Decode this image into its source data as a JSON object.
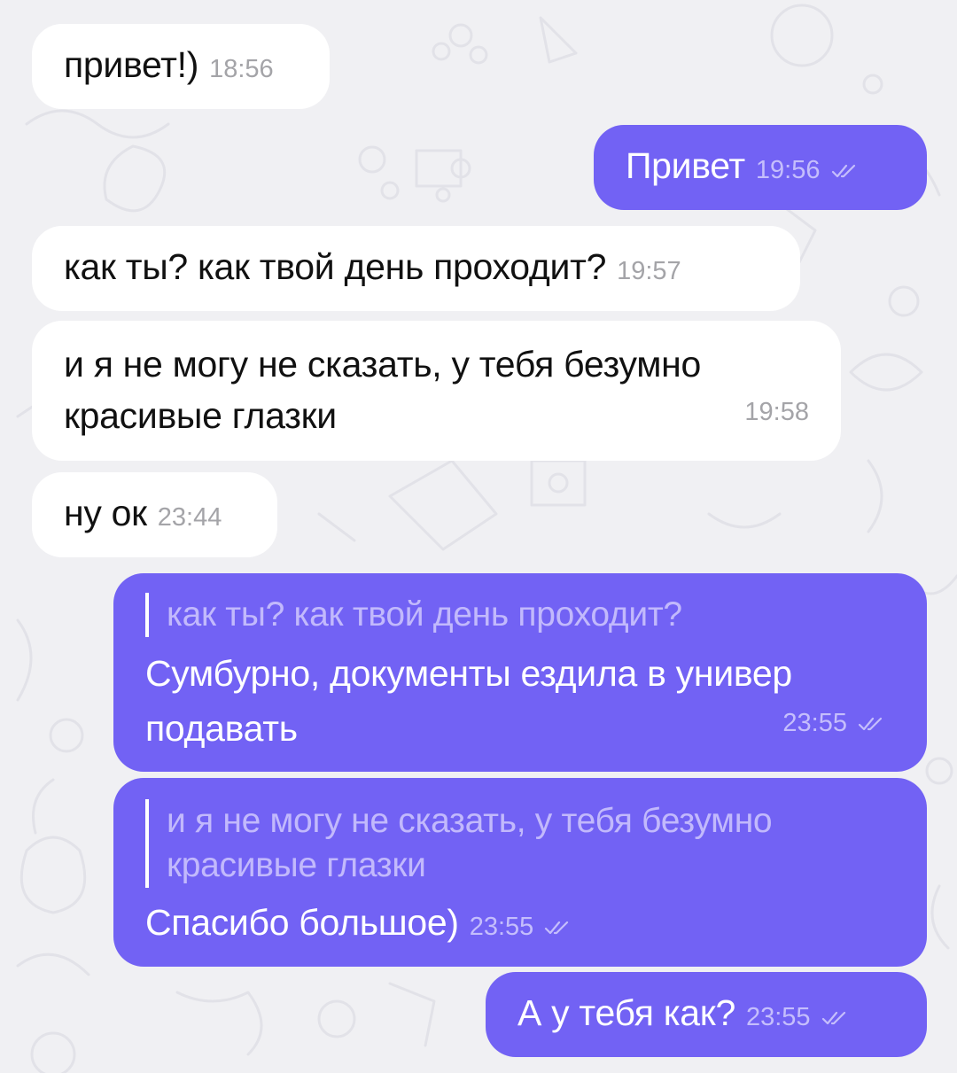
{
  "colors": {
    "chat_background": "#f0f0f3",
    "incoming_bubble": "#ffffff",
    "outgoing_bubble": "#7262f4",
    "incoming_text": "#111111",
    "outgoing_text": "#ffffff",
    "incoming_time": "#a4a4a8",
    "outgoing_time": "#c5befc"
  },
  "icons": {
    "read_status": "double-check-icon",
    "background_pattern": "doodle-pattern"
  },
  "messages": [
    {
      "direction": "in",
      "text": "привет!)",
      "time": "18:56"
    },
    {
      "direction": "out",
      "text": "Привет",
      "time": "19:56",
      "status": "read"
    },
    {
      "direction": "in",
      "text": "как ты? как твой день проходит?",
      "time": "19:57"
    },
    {
      "direction": "in",
      "text_lines": [
        "и я не могу не сказать, у тебя безумно",
        "красивые глазки"
      ],
      "time": "19:58"
    },
    {
      "direction": "in",
      "text": "ну ок",
      "time": "23:44"
    },
    {
      "direction": "out",
      "reply_to": "как ты? как твой день проходит?",
      "text_lines": [
        "Сумбурно, документы ездила в универ",
        "подавать"
      ],
      "time": "23:55",
      "status": "read"
    },
    {
      "direction": "out",
      "reply_to_lines": [
        "и я не могу не сказать, у тебя безумно",
        "красивые глазки"
      ],
      "text": "Спасибо большое)",
      "time": "23:55",
      "status": "read"
    },
    {
      "direction": "out",
      "text": "А у тебя как?",
      "time": "23:55",
      "status": "read"
    }
  ]
}
